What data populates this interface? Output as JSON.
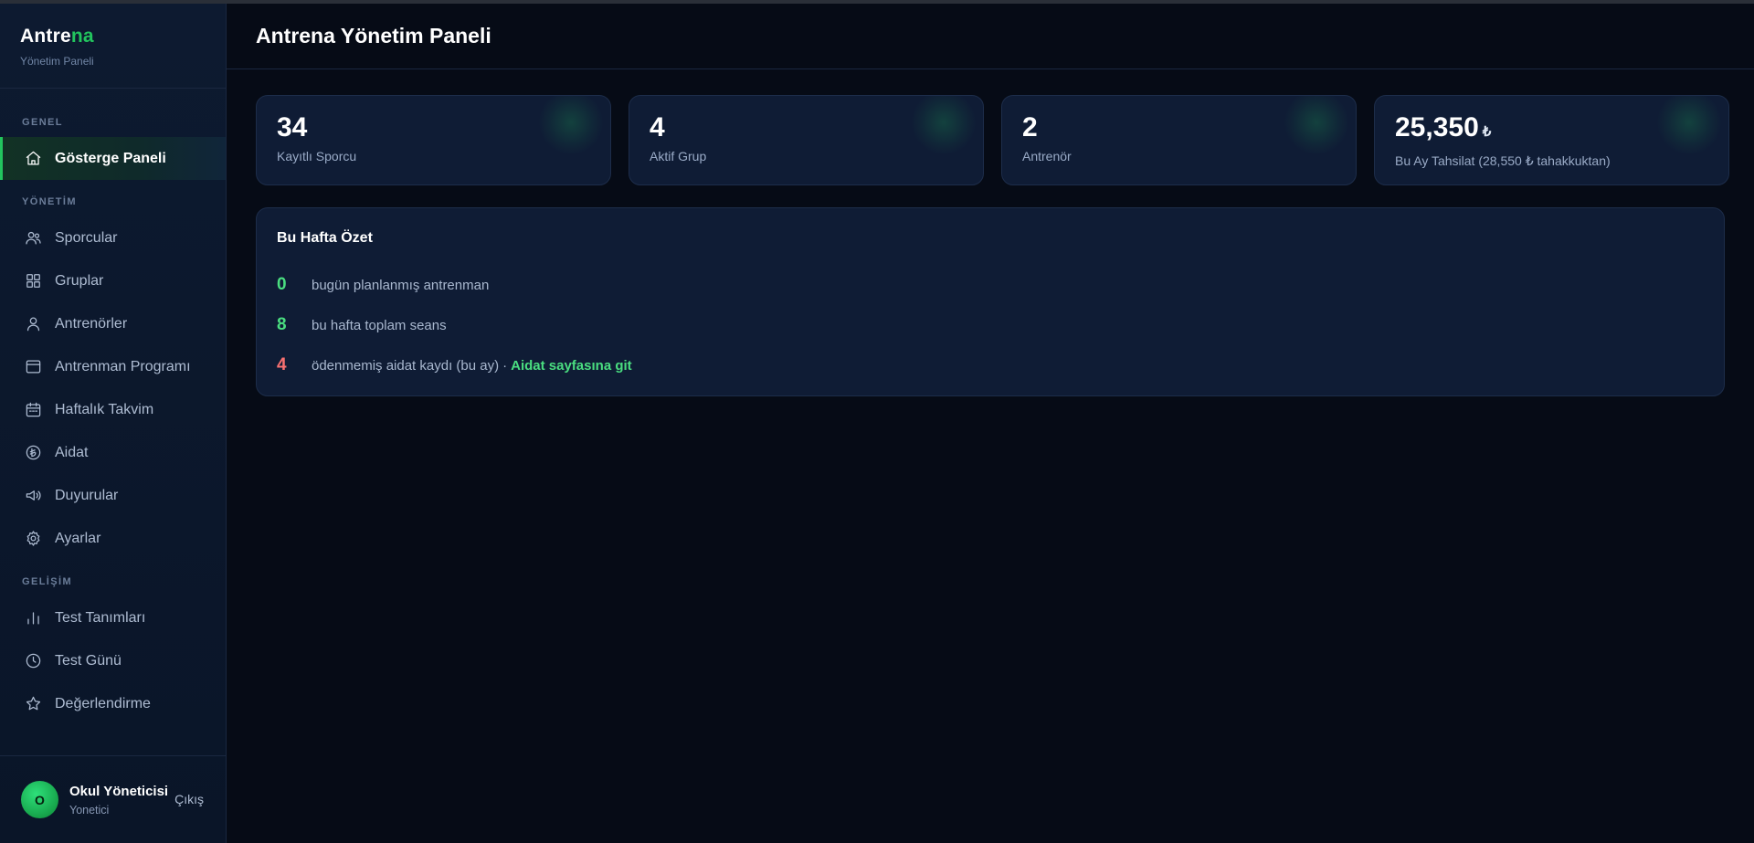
{
  "brand": {
    "name_part1": "Antre",
    "name_part2": "na",
    "subtitle": "Yönetim Paneli"
  },
  "sidebar": {
    "sections": [
      {
        "label": "GENEL",
        "items": [
          {
            "label": "Gösterge Paneli",
            "icon": "home-icon",
            "active": true
          }
        ]
      },
      {
        "label": "YÖNETİM",
        "items": [
          {
            "label": "Sporcular",
            "icon": "users-icon"
          },
          {
            "label": "Gruplar",
            "icon": "grid-icon"
          },
          {
            "label": "Antrenörler",
            "icon": "user-icon"
          },
          {
            "label": "Antrenman Programı",
            "icon": "window-icon"
          },
          {
            "label": "Haftalık Takvim",
            "icon": "calendar-icon"
          },
          {
            "label": "Aidat",
            "icon": "lira-circle-icon"
          },
          {
            "label": "Duyurular",
            "icon": "megaphone-icon"
          },
          {
            "label": "Ayarlar",
            "icon": "gear-icon"
          }
        ]
      },
      {
        "label": "GELİŞİM",
        "items": [
          {
            "label": "Test Tanımları",
            "icon": "bar-chart-icon"
          },
          {
            "label": "Test Günü",
            "icon": "clock-icon"
          },
          {
            "label": "Değerlendirme",
            "icon": "star-icon"
          }
        ]
      }
    ]
  },
  "user": {
    "initial": "O",
    "name": "Okul Yöneticisi",
    "role": "Yonetici",
    "logout_label": "Çıkış"
  },
  "header": {
    "title": "Antrena Yönetim Paneli"
  },
  "stats": [
    {
      "value": "34",
      "unit": "",
      "label": "Kayıtlı Sporcu"
    },
    {
      "value": "4",
      "unit": "",
      "label": "Aktif Grup"
    },
    {
      "value": "2",
      "unit": "",
      "label": "Antrenör"
    },
    {
      "value": "25,350",
      "unit": "₺",
      "label": "Bu Ay Tahsilat (28,550 ₺ tahakkuktan)"
    }
  ],
  "summary": {
    "title": "Bu Hafta Özet",
    "rows": [
      {
        "num": "0",
        "text": "bugün planlanmış antrenman",
        "color": "#4ade80"
      },
      {
        "num": "8",
        "text": "bu hafta toplam seans",
        "color": "#4ade80"
      },
      {
        "num": "4",
        "text": "ödenmemiş aidat kaydı (bu ay)",
        "separator": "·",
        "link": "Aidat sayfasına git",
        "color": "#f87171"
      }
    ]
  },
  "colors": {
    "accent": "#22c55e",
    "danger": "#f87171",
    "background": "#060b16",
    "card": "#0f1c35"
  }
}
